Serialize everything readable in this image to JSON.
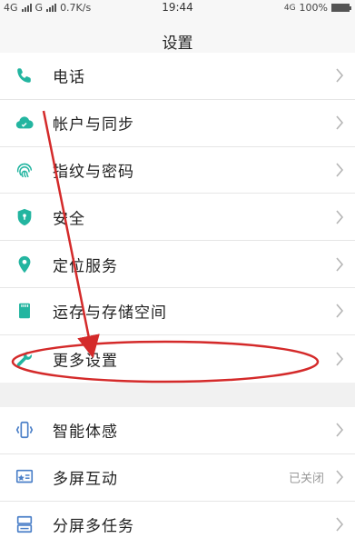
{
  "status": {
    "net1": "4G",
    "net2": "G",
    "speed": "0.7K/s",
    "time": "19:44",
    "net3": "4G",
    "battery": "100%",
    "battery_level": 1.0
  },
  "header": {
    "title": "设置"
  },
  "group1": [
    {
      "label": "电话",
      "icon": "phone-icon"
    },
    {
      "label": "帐户与同步",
      "icon": "cloud-sync-icon"
    },
    {
      "label": "指纹与密码",
      "icon": "fingerprint-icon"
    },
    {
      "label": "安全",
      "icon": "shield-icon"
    },
    {
      "label": "定位服务",
      "icon": "location-pin-icon"
    },
    {
      "label": "运存与存储空间",
      "icon": "sd-card-icon"
    },
    {
      "label": "更多设置",
      "icon": "wrench-icon"
    }
  ],
  "group2": [
    {
      "label": "智能体感",
      "icon": "phone-motion-icon",
      "value": ""
    },
    {
      "label": "多屏互动",
      "icon": "screen-cast-icon",
      "value": "已关闭"
    },
    {
      "label": "分屏多任务",
      "icon": "split-screen-icon",
      "value": ""
    }
  ],
  "colors": {
    "accent": "#23b5a0",
    "blue_icon": "#4a7fc8",
    "annotation": "#d42a2a"
  }
}
